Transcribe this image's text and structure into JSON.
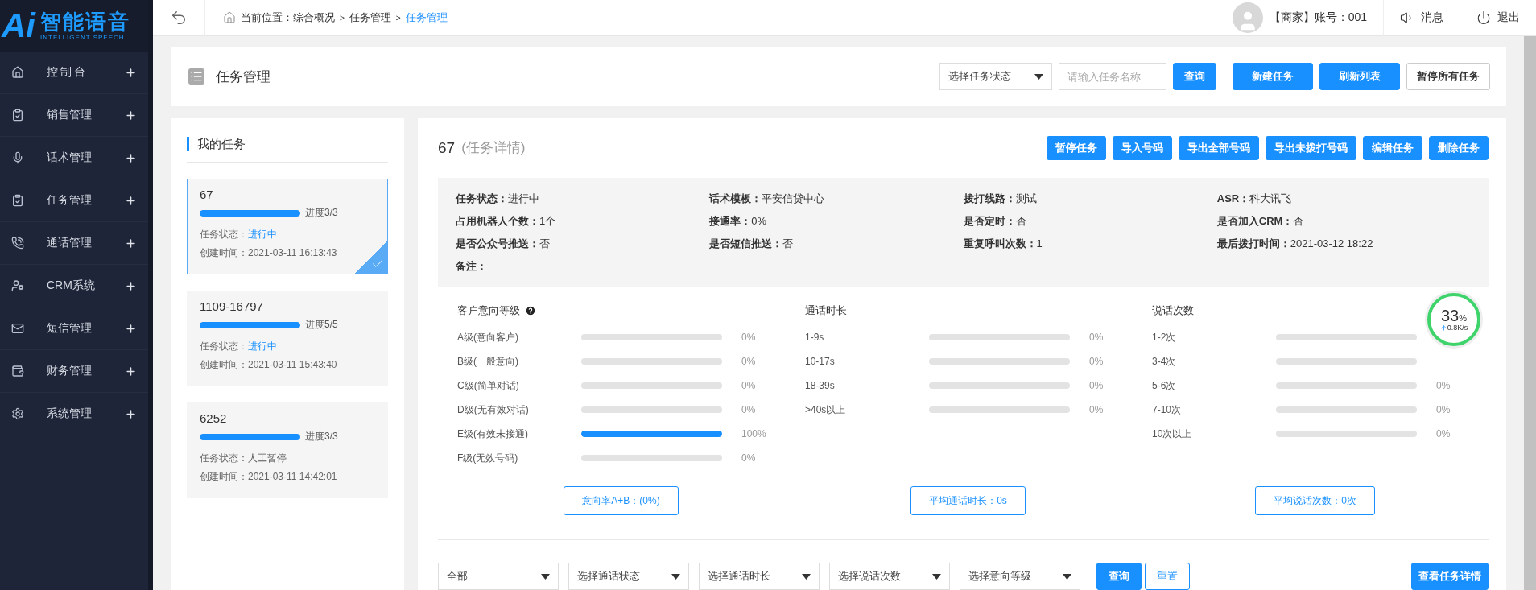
{
  "logo": {
    "mark": "Ai",
    "title": "智能语音",
    "subtitle": "INTELLIGENT SPEECH"
  },
  "sidebar": {
    "items": [
      {
        "label": "控制台",
        "expanded": false
      },
      {
        "label": "销售管理",
        "expanded": false
      },
      {
        "label": "话术管理",
        "expanded": false
      },
      {
        "label": "任务管理",
        "expanded": false
      },
      {
        "label": "通话管理",
        "expanded": false
      },
      {
        "label": "CRM系统",
        "expanded": false
      },
      {
        "label": "短信管理",
        "expanded": false
      },
      {
        "label": "财务管理",
        "expanded": false
      },
      {
        "label": "系统管理",
        "expanded": false
      }
    ]
  },
  "topbar": {
    "location_label": "当前位置：",
    "breadcrumb": [
      {
        "label": "综合概况",
        "current": false
      },
      {
        "label": "任务管理",
        "current": false
      },
      {
        "label": "任务管理",
        "current": true
      }
    ],
    "separator": ">",
    "account": "【商家】账号：001",
    "messages": "消息",
    "logout": "退出"
  },
  "page_header": {
    "title": "任务管理",
    "status_select": "选择任务状态",
    "search_placeholder": "请输入任务名称",
    "buttons": [
      {
        "label": "查询",
        "kind": "primary"
      },
      {
        "label": "新建任务",
        "kind": "primary"
      },
      {
        "label": "刷新列表",
        "kind": "primary"
      },
      {
        "label": "暂停所有任务",
        "kind": "outline"
      }
    ]
  },
  "my_tasks": {
    "title": "我的任务",
    "items": [
      {
        "name": "67",
        "level": 1,
        "progress": "进度3/3",
        "status_label": "任务状态：",
        "status": "进行中",
        "running": true,
        "created": "创建时间：2021-03-11 16:13:43",
        "selected": true
      },
      {
        "name": "1109-16797",
        "level": 1,
        "progress": "进度5/5",
        "status_label": "任务状态：",
        "status": "进行中",
        "running": true,
        "created": "创建时间：2021-03-11 15:43:40",
        "selected": false
      },
      {
        "name": "6252",
        "level": 1,
        "progress": "进度3/3",
        "status_label": "任务状态：",
        "status": "人工暂停",
        "running": false,
        "created": "创建时间：2021-03-11 14:42:01",
        "selected": false
      }
    ]
  },
  "detail": {
    "id": "67",
    "subtitle": "(任务详情)",
    "buttons": [
      "暂停任务",
      "导入号码",
      "导出全部号码",
      "导出未拨打号码",
      "编辑任务",
      "删除任务"
    ],
    "fields": [
      {
        "label": "任务状态：",
        "value": "进行中"
      },
      {
        "label": "话术模板：",
        "value": "平安信贷中心"
      },
      {
        "label": "拨打线路：",
        "value": "测试"
      },
      {
        "label": "ASR：",
        "value": "科大讯飞"
      },
      {
        "label": "占用机器人个数：",
        "value": "1个"
      },
      {
        "label": "接通率：",
        "value": "0%"
      },
      {
        "label": "是否定时：",
        "value": "否"
      },
      {
        "label": "是否加入CRM：",
        "value": "否"
      },
      {
        "label": "是否公众号推送：",
        "value": "否"
      },
      {
        "label": "是否短信推送：",
        "value": "否"
      },
      {
        "label": "重复呼叫次数：",
        "value": "1"
      },
      {
        "label": "最后拨打时间：",
        "value": "2021-03-12 18:22"
      },
      {
        "label": "备注："
      }
    ],
    "stats": [
      {
        "title": "客户意向等级",
        "help": true,
        "rows": [
          {
            "label": "A级(意向客户)",
            "level": 0,
            "percent": "0%"
          },
          {
            "label": "B级(一般意向)",
            "level": 0,
            "percent": "0%"
          },
          {
            "label": "C级(简单对话)",
            "level": 0,
            "percent": "0%"
          },
          {
            "label": "D级(无有效对话)",
            "level": 0,
            "percent": "0%"
          },
          {
            "label": "E级(有效未接通)",
            "level": 1,
            "percent": "100%"
          },
          {
            "label": "F级(无效号码)",
            "level": 0,
            "percent": "0%"
          }
        ],
        "summary": "意向率A+B：(0%)"
      },
      {
        "title": "通话时长",
        "help": false,
        "rows": [
          {
            "label": "1-9s",
            "level": 0,
            "percent": "0%"
          },
          {
            "label": "10-17s",
            "level": 0,
            "percent": "0%"
          },
          {
            "label": "18-39s",
            "level": 0,
            "percent": "0%"
          },
          {
            "label": ">40s以上",
            "level": 0,
            "percent": "0%"
          }
        ],
        "summary": "平均通话时长：0s"
      },
      {
        "title": "说话次数",
        "help": false,
        "rows": [
          {
            "label": "1-2次",
            "level": 0
          },
          {
            "label": "3-4次",
            "level": 0
          },
          {
            "label": "5-6次",
            "level": 0,
            "percent": "0%"
          },
          {
            "label": "7-10次",
            "level": 0,
            "percent": "0%"
          },
          {
            "label": "10次以上",
            "level": 0,
            "percent": "0%"
          }
        ],
        "summary": "平均说话次数：0次"
      }
    ],
    "filters": [
      "全部",
      "选择通话状态",
      "选择通话时长",
      "选择说话次数",
      "选择意向等级"
    ],
    "query": "查询",
    "reset": "重置",
    "view_details": "查看任务详情"
  },
  "speed_widget": {
    "percent": "33",
    "unit": "%",
    "speed": "0.8K/s"
  }
}
